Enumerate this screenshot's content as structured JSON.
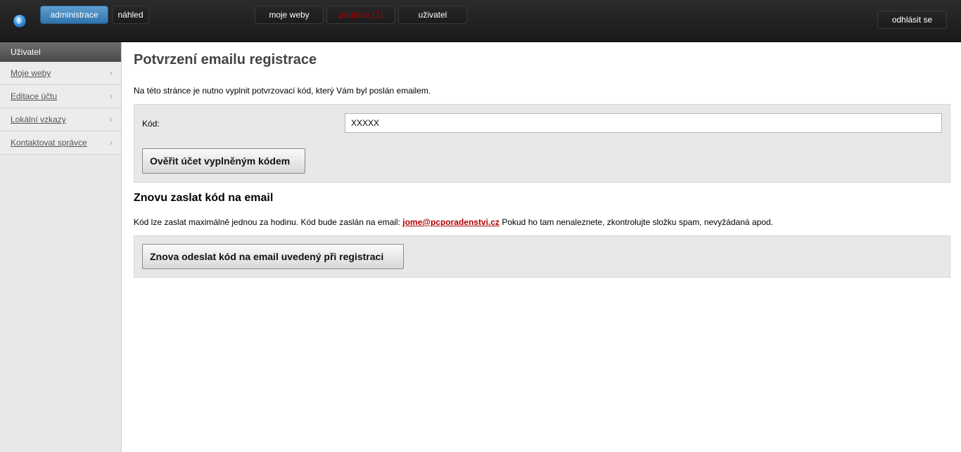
{
  "topbar": {
    "logo_icon": "globe-icon",
    "admin_label": "administrace",
    "preview_label": "náhled",
    "nav": [
      {
        "label": "moje weby"
      },
      {
        "label": "podpora (1)",
        "color": "#b00000"
      },
      {
        "label": "uživatel"
      }
    ],
    "logout_label": "odhlásit se"
  },
  "sidebar": {
    "title": "Uživatel",
    "items": [
      {
        "label": "Moje weby"
      },
      {
        "label": "Editace účtu"
      },
      {
        "label": "Lokální vzkazy"
      },
      {
        "label": "Kontaktovat správce"
      }
    ],
    "chevron_icon": "chevron-right-icon"
  },
  "main": {
    "title": "Potvrzení emailu registrace",
    "intro": "Na této stránce je nutno vyplnit potvrzovací kód, který Vám byl poslán emailem.",
    "code_label": "Kód:",
    "code_value": "XXXXX",
    "verify_button": "Ověřit účet vyplněným kódem",
    "resend_title": "Znovu zaslat kód na email",
    "resend_note_before": "Kód lze zaslat maximálně jednou za hodinu. Kód bude zaslán na email: ",
    "resend_email": "jome@pcporadenstvi.cz",
    "resend_note_after": " Pokud ho tam nenaleznete, zkontrolujte složku spam, nevyžádaná apod.",
    "resend_button": "Znova odeslat kód na email uvedený při registraci"
  },
  "colors": {
    "accent_blue": "#2f74ad",
    "link_red": "#b00000",
    "topbar_dark": "#1f1f1f"
  }
}
